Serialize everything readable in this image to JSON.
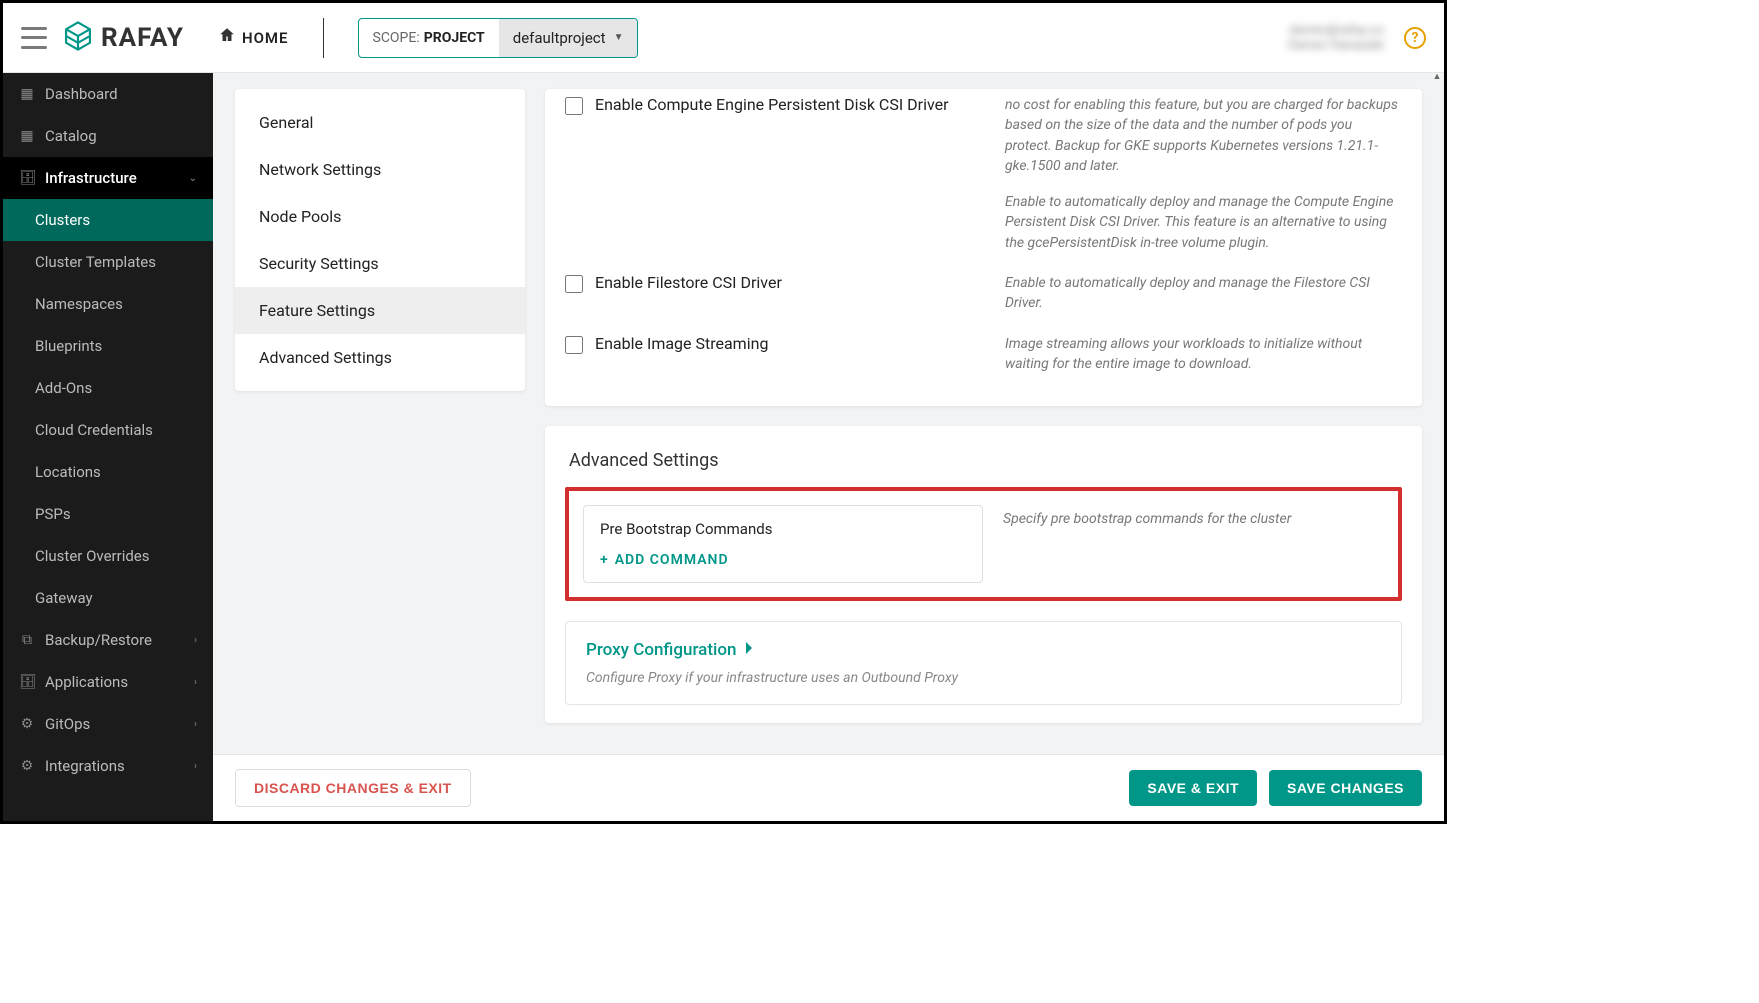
{
  "header": {
    "brand": "RAFAY",
    "home": "HOME",
    "scope_prefix": "SCOPE:",
    "scope_kind": "PROJECT",
    "scope_project": "defaultproject",
    "user_line1": "darren@rafay.co",
    "user_line2": "Darren Hanasaki"
  },
  "sidebar": {
    "items": [
      {
        "label": "Dashboard",
        "icon": "grid"
      },
      {
        "label": "Catalog",
        "icon": "grid"
      },
      {
        "label": "Infrastructure",
        "icon": "briefcase",
        "section": true,
        "expanded": true,
        "children": [
          {
            "label": "Clusters",
            "active": true
          },
          {
            "label": "Cluster Templates"
          },
          {
            "label": "Namespaces"
          },
          {
            "label": "Blueprints"
          },
          {
            "label": "Add-Ons"
          },
          {
            "label": "Cloud Credentials"
          },
          {
            "label": "Locations"
          },
          {
            "label": "PSPs"
          },
          {
            "label": "Cluster Overrides"
          },
          {
            "label": "Gateway"
          }
        ]
      },
      {
        "label": "Backup/Restore",
        "icon": "copy",
        "chevron": true
      },
      {
        "label": "Applications",
        "icon": "briefcase",
        "chevron": true
      },
      {
        "label": "GitOps",
        "icon": "sliders",
        "chevron": true
      },
      {
        "label": "Integrations",
        "icon": "sliders",
        "chevron": true
      }
    ]
  },
  "inner_nav": [
    {
      "label": "General"
    },
    {
      "label": "Network Settings"
    },
    {
      "label": "Node Pools"
    },
    {
      "label": "Security Settings"
    },
    {
      "label": "Feature Settings",
      "active": true
    },
    {
      "label": "Advanced Settings"
    }
  ],
  "features": [
    {
      "label": "Enable Compute Engine Persistent Disk CSI Driver",
      "desc_parts": [
        "no cost for enabling this feature, but you are charged for backups based on the size of the data and the number of pods you protect. Backup for GKE supports Kubernetes versions 1.21.1-gke.1500 and later.",
        "Enable to automatically deploy and manage the Compute Engine Persistent Disk CSI Driver. This feature is an alternative to using the gcePersistentDisk in-tree volume plugin."
      ]
    },
    {
      "label": "Enable Filestore CSI Driver",
      "desc_parts": [
        "Enable to automatically deploy and manage the Filestore CSI Driver."
      ]
    },
    {
      "label": "Enable Image Streaming",
      "desc_parts": [
        "Image streaming allows your workloads to initialize without waiting for the entire image to download."
      ]
    }
  ],
  "advanced": {
    "title": "Advanced Settings",
    "prebootstrap": {
      "title": "Pre Bootstrap Commands",
      "add": "ADD  COMMAND",
      "desc": "Specify pre bootstrap commands for the cluster"
    },
    "proxy": {
      "title": "Proxy Configuration",
      "desc": "Configure Proxy if your infrastructure uses an Outbound Proxy"
    }
  },
  "footer": {
    "discard": "DISCARD CHANGES & EXIT",
    "save_exit": "SAVE & EXIT",
    "save": "SAVE CHANGES"
  }
}
